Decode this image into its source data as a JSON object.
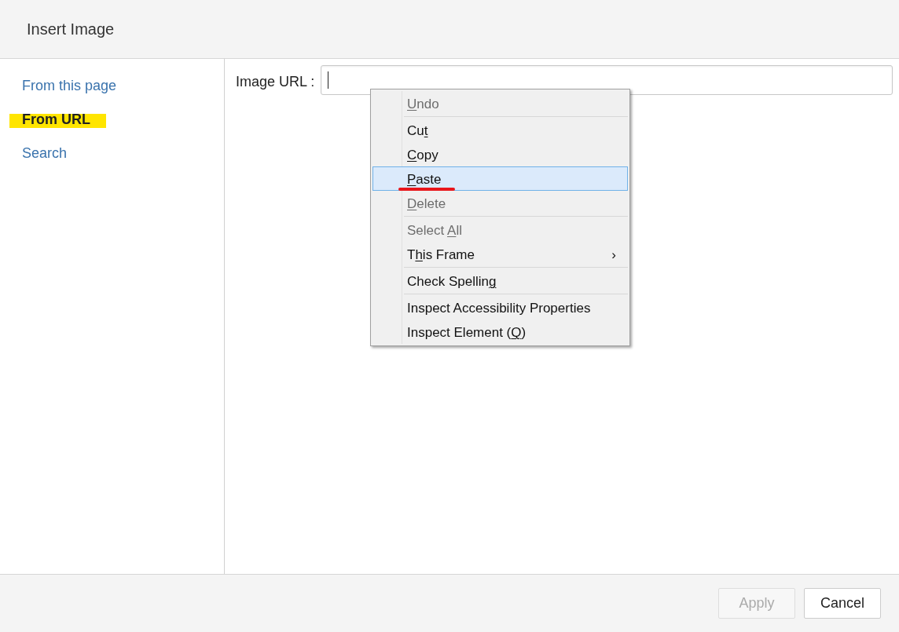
{
  "dialog": {
    "title": "Insert Image"
  },
  "sidebar": {
    "items": [
      {
        "label": "From this page",
        "selected": false
      },
      {
        "label": "From URL",
        "selected": true
      },
      {
        "label": "Search",
        "selected": false
      }
    ]
  },
  "url_field": {
    "label": "Image URL :"
  },
  "context_menu": {
    "items": [
      {
        "kind": "item",
        "access_key": "U",
        "label_end": "ndo",
        "disabled": true,
        "selected": false
      },
      {
        "kind": "separator"
      },
      {
        "kind": "item",
        "label_start": "Cu",
        "access_key": "t",
        "disabled": false,
        "selected": false
      },
      {
        "kind": "item",
        "access_key": "C",
        "label_end": "opy",
        "disabled": false,
        "selected": false
      },
      {
        "kind": "item",
        "access_key": "P",
        "label_end": "aste",
        "disabled": false,
        "selected": true,
        "annotated": true
      },
      {
        "kind": "item",
        "access_key": "D",
        "label_end": "elete",
        "disabled": true,
        "selected": false
      },
      {
        "kind": "separator"
      },
      {
        "kind": "item",
        "label_start": "Select ",
        "access_key": "A",
        "label_end": "ll",
        "disabled": true,
        "selected": false
      },
      {
        "kind": "submenu",
        "label_start": "T",
        "access_key": "h",
        "label_end": "is Frame",
        "disabled": false,
        "selected": false,
        "arrow": "›"
      },
      {
        "kind": "separator"
      },
      {
        "kind": "item",
        "label_start": "Check Spellin",
        "access_key": "g",
        "disabled": false,
        "selected": false
      },
      {
        "kind": "separator"
      },
      {
        "kind": "item",
        "label": "Inspect Accessibility Properties",
        "disabled": false,
        "selected": false
      },
      {
        "kind": "item",
        "label_start": "Inspect Element (",
        "access_key": "Q",
        "label_end": ")",
        "disabled": false,
        "selected": false
      }
    ]
  },
  "buttons": [
    {
      "label": "Apply",
      "disabled": true
    },
    {
      "label": "Cancel",
      "disabled": false
    }
  ]
}
